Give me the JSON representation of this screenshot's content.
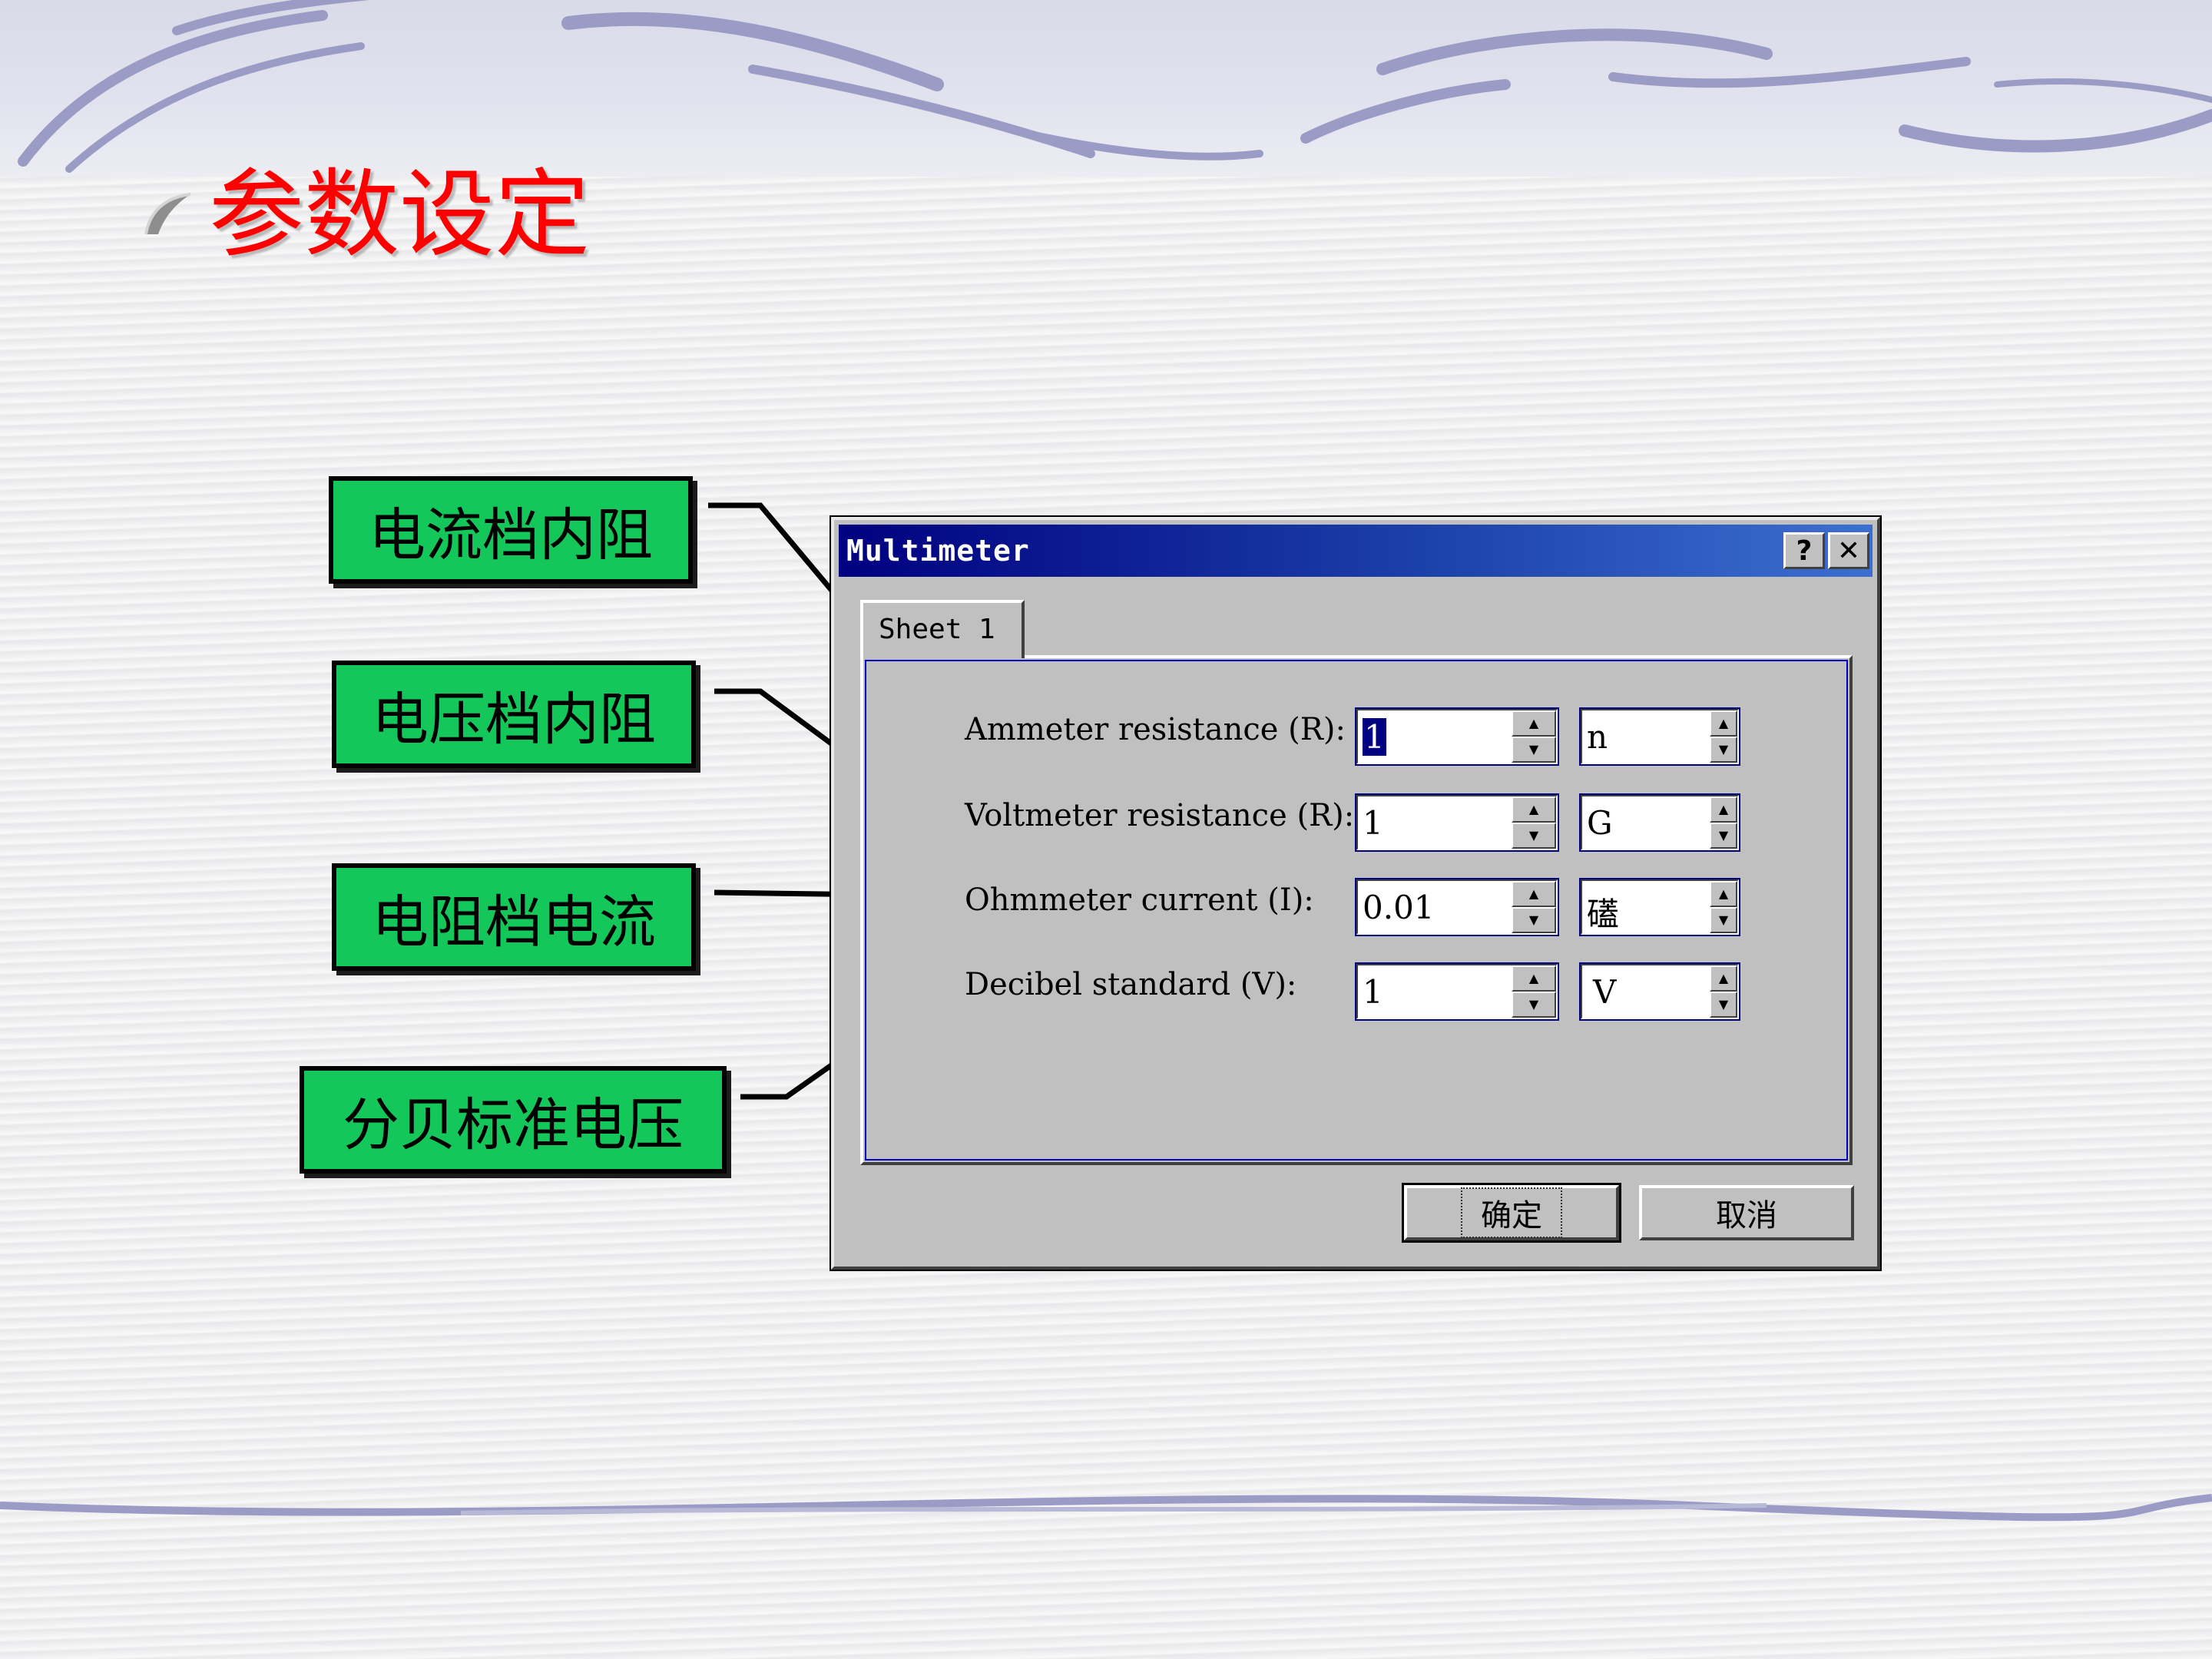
{
  "slide": {
    "title": "参数设定",
    "callouts": [
      "电流档内阻",
      "电压档内阻",
      "电阻档电流",
      "分贝标准电压"
    ]
  },
  "dialog": {
    "title": "Multimeter",
    "help_button": "?",
    "close_button": "✕",
    "tab": "Sheet 1",
    "fields": [
      {
        "label": "Ammeter resistance (R):",
        "value": "1",
        "unit": "n"
      },
      {
        "label": "Voltmeter resistance (R):",
        "value": "1",
        "unit": "G"
      },
      {
        "label": "Ohmmeter current (I):",
        "value": "0.01",
        "unit": "礚"
      },
      {
        "label": "Decibel standard (V):",
        "value": "1",
        "unit": "V"
      }
    ],
    "ok_button": "确定",
    "cancel_button": "取消"
  },
  "colors": {
    "title_red": "#ff0000",
    "callout_green": "#14c75b",
    "dialog_face": "#c0c0c0",
    "titlebar_blue": "#000080"
  }
}
